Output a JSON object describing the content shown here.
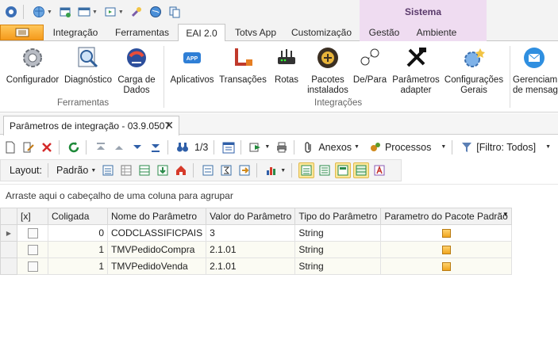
{
  "ribbon_context": {
    "group_title": "Sistema"
  },
  "tabs": [
    {
      "label": "Integração"
    },
    {
      "label": "Ferramentas"
    },
    {
      "label": "EAI 2.0"
    },
    {
      "label": "Totvs App"
    },
    {
      "label": "Customização"
    },
    {
      "label": "Gestão"
    },
    {
      "label": "Ambiente"
    }
  ],
  "ribbon": {
    "ferramentas": {
      "configurador": "Configurador",
      "diagnostico": "Diagnóstico",
      "carga_line1": "Carga de",
      "carga_line2": "Dados",
      "group_label": "Ferramentas"
    },
    "integracoes": {
      "aplicativos": "Aplicativos",
      "transacoes": "Transações",
      "rotas": "Rotas",
      "pacotes_line1": "Pacotes",
      "pacotes_line2": "instalados",
      "depara": "De/Para",
      "parametros_line1": "Parâmetros",
      "parametros_line2": "adapter",
      "config_line1": "Configurações",
      "config_line2": "Gerais",
      "group_label": "Integrações"
    },
    "extra": {
      "gerenc_line1": "Gerenciam",
      "gerenc_line2": "de mensag"
    },
    "app_icon_text": "APP"
  },
  "document_tab": {
    "title": "Parâmetros de integração - 03.9.0507",
    "close": "✕"
  },
  "toolbar": {
    "page_counter": "1/3",
    "anexos": "Anexos",
    "processos": "Processos",
    "filtro": "[Filtro: Todos]"
  },
  "layout_bar": {
    "label": "Layout:",
    "value": "Padrão"
  },
  "group_panel_text": "Arraste aqui o cabeçalho de uma coluna para agrupar",
  "grid": {
    "columns": [
      "[x]",
      "Coligada",
      "Nome do Parâmetro",
      "Valor do Parâmetro",
      "Tipo do Parâmetro",
      "Parametro do Pacote Padrão"
    ],
    "rows": [
      {
        "coligada": "0",
        "nome": "CODCLASSIFICPAIS",
        "valor": "3",
        "tipo": "String"
      },
      {
        "coligada": "1",
        "nome": "TMVPedidoCompra",
        "valor": "2.1.01",
        "tipo": "String"
      },
      {
        "coligada": "1",
        "nome": "TMVPedidoVenda",
        "valor": "2.1.01",
        "tipo": "String"
      }
    ]
  },
  "colors": {
    "accent_orange": "#f59a1c",
    "context_band": "#efdcf1",
    "highlight": "#fbe79a"
  }
}
